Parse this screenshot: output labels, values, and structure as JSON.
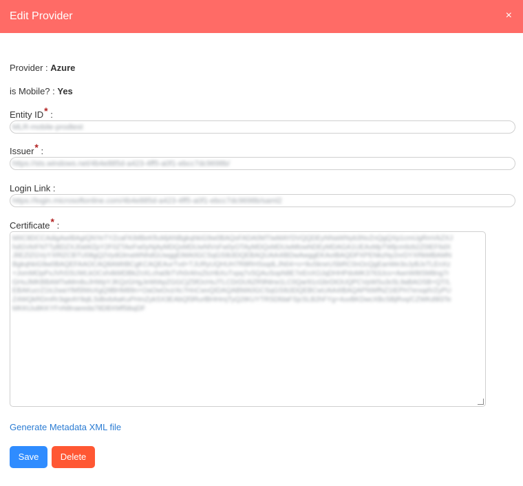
{
  "header": {
    "title": "Edit Provider",
    "close_symbol": "×"
  },
  "provider": {
    "label": "Provider : ",
    "value": "Azure"
  },
  "mobile": {
    "label": "is Mobile? : ",
    "value": "Yes"
  },
  "entity_id": {
    "label": "Entity ID",
    "required_mark": "*",
    "colon": " :",
    "value": "MLR-mobile-prodtest"
  },
  "issuer": {
    "label": "Issuer",
    "required_mark": "*",
    "colon": " :",
    "value": "https://sts.windows.net/4b4e885d-a423-4ff5-a0f1-ebcc7dc9698b/"
  },
  "login_link": {
    "label": "Login Link :",
    "value": "https://login.microsoftonline.com/4b4e885d-a423-4ff5-a0f1-ebcc7dc9698b/saml2"
  },
  "certificate": {
    "label": "Certificate",
    "required_mark": "*",
    "colon": " :",
    "value": "MIIC8DCCAdigAwIBAgIQNYeTYZcaFKiMBeKfIuMjANBgkqhkiG9w0BAQsFADA0MTIwMAYDVQQDEyNNaWNyb3NvZnQgQXp1cmUgRmVkZXJhdGVkIFNTTyBDZXJ0aWZpY2F0ZTAeFw0yNjAyMDQxMDUwNlVsFw0yOTAyMDQxMDUwMlowNDEyMDAGA1UEAxMpTWljcm9zb2Z0IEF6dXJlIEZlZGVyYXRlZCBTU08gQ2VydGlmaWNhdGUwggEiMA0GCSqGSIb3DQEBAQUAA4IBDwAwggEKAoIBAQDPXPENkzNy2nrDYXRkMBAMNBgkqhkiG9w0BAQEFAAOCAQ8AMIIBCgKCAQEAurTvd+TJURyUQHUH7R8RHSsqdLJN04+o+9uSkneUSbRC0nOcQgEanWe3oJyBJxTLEnXz+JomMOpPxJVhSSUWLkOCxh4kMDBkZnXLcha0bTVh0rAhsZtcHbXuTxpq7vSQAuSopN8E7eEnXOJqDHHPdoMK3763Jco+AwnW8tSM8ng7rGHuJMKBBAMTwMm8uJHWpYJKQzGHgJeWtApZGGCjZ5fOcHsJTLCDrDU6ZR9Ntrw1LC0Qar91cGbrDtOUQPCVpWSu3c5L9aBAOSB+QT/LEBAKucrZ1tc2waYlM5lWoXgQ9BHM89n+OaOwOvz/4c7HnCwvQIDAQABMA0GCSqGSIb3DQEBCwUAA4IBAQAPNWfNZ1tEPH7erxqdVZyPUZ4WQkRDmRr3qjeAY8qlLSdbvbAaKuPHmZykSX3EAbQf3RurlBHHmjTyQ2tKUYTRSDfdaFSjcSLB2hFYg+4uvBKDwcXBcSBjRvq/CZWKd9l3TeMKKtJu8KKYFnN8naeeda78DBXMf5ibqDF",
    "resize_icon": "resize-grip-icon"
  },
  "metadata_link": "Generate Metadata XML file",
  "buttons": {
    "save": "Save",
    "delete": "Delete"
  },
  "colors": {
    "header_bg": "#ff6b66",
    "save_bg": "#2f8cff",
    "delete_bg": "#ff5733",
    "link": "#2b7cd3",
    "required": "#b22222"
  }
}
